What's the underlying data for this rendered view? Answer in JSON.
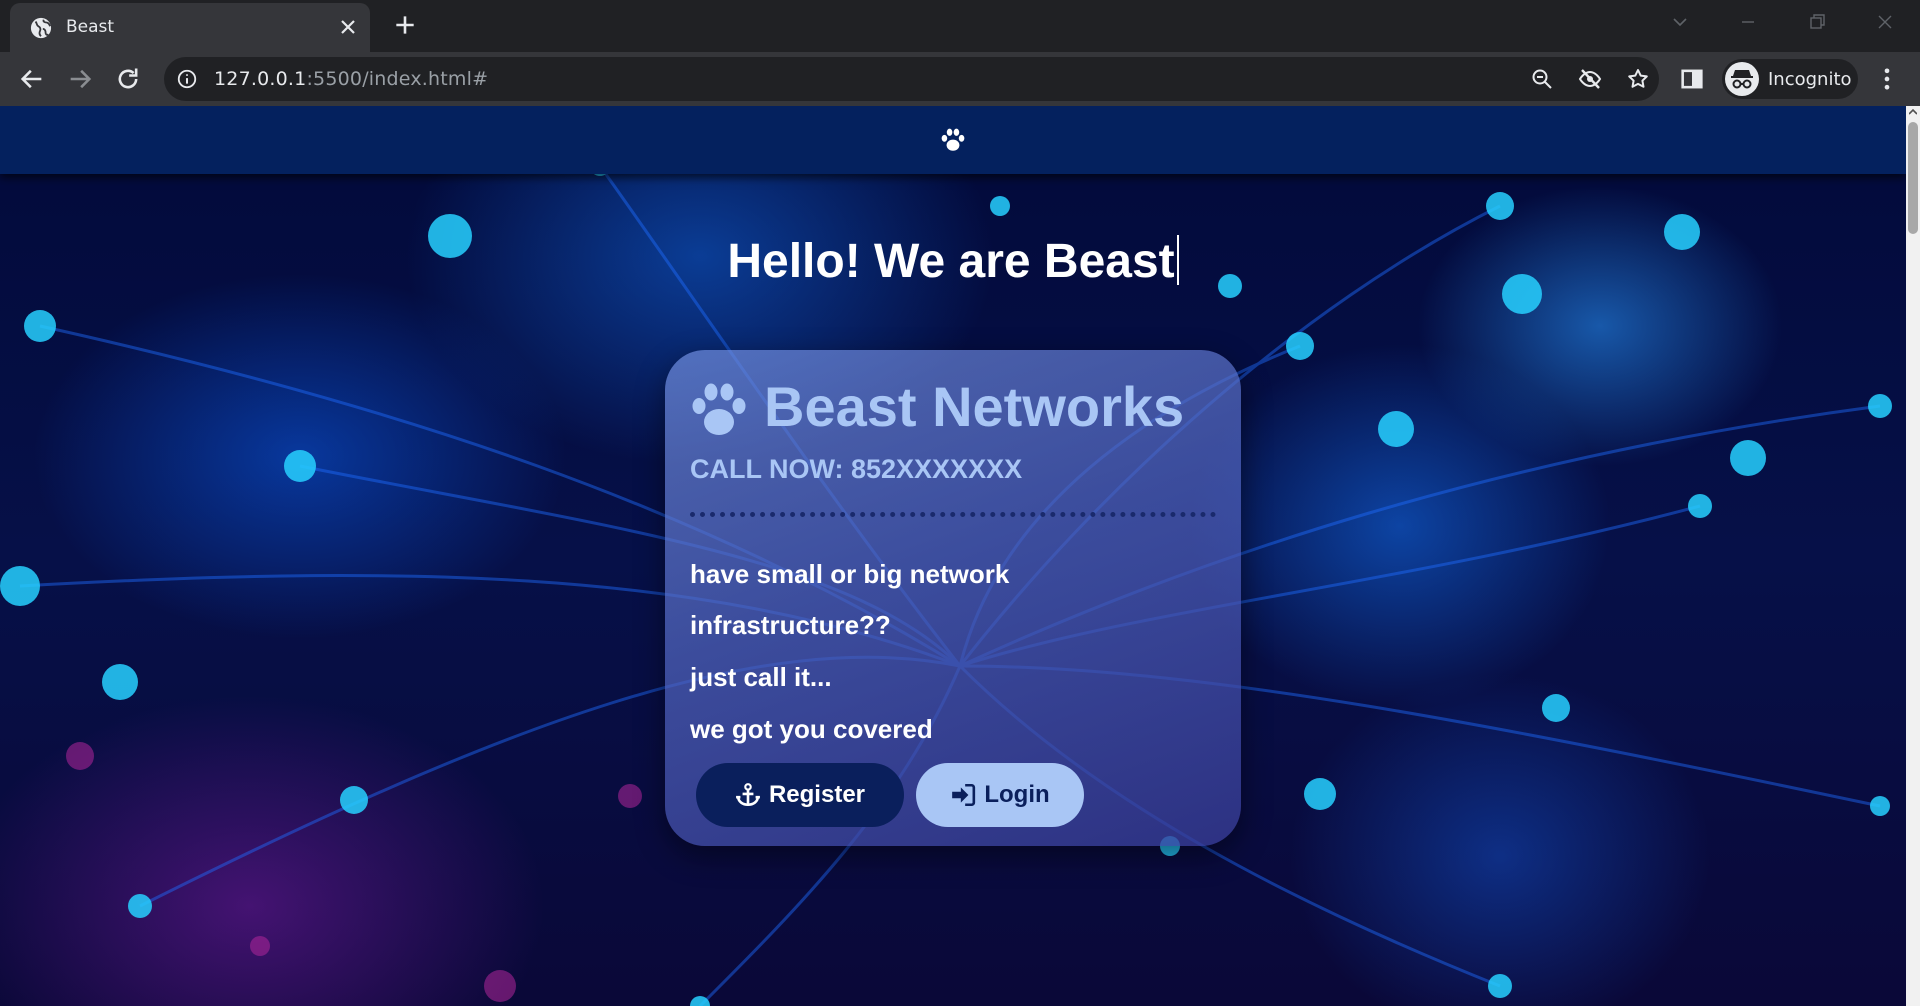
{
  "browser": {
    "tab_title": "Beast",
    "url_host": "127.0.0.1",
    "url_rest": ":5500/index.html#",
    "profile_label": "Incognito"
  },
  "hero": {
    "title": "Hello! We are Beast"
  },
  "card": {
    "brand": "Beast Networks",
    "call_now": "CALL NOW: 852XXXXXXX",
    "lines": [
      "have small or big network",
      "infrastructure??",
      "just call it...",
      "we got you covered"
    ],
    "register_label": "Register",
    "login_label": "Login"
  },
  "colors": {
    "navbar": "#04215e",
    "accent_light": "#a9c6f5",
    "button_dark": "#0a1f5c"
  },
  "icons": {
    "brand": "paw-icon",
    "register": "anchor-icon",
    "login": "sign-in-icon"
  }
}
